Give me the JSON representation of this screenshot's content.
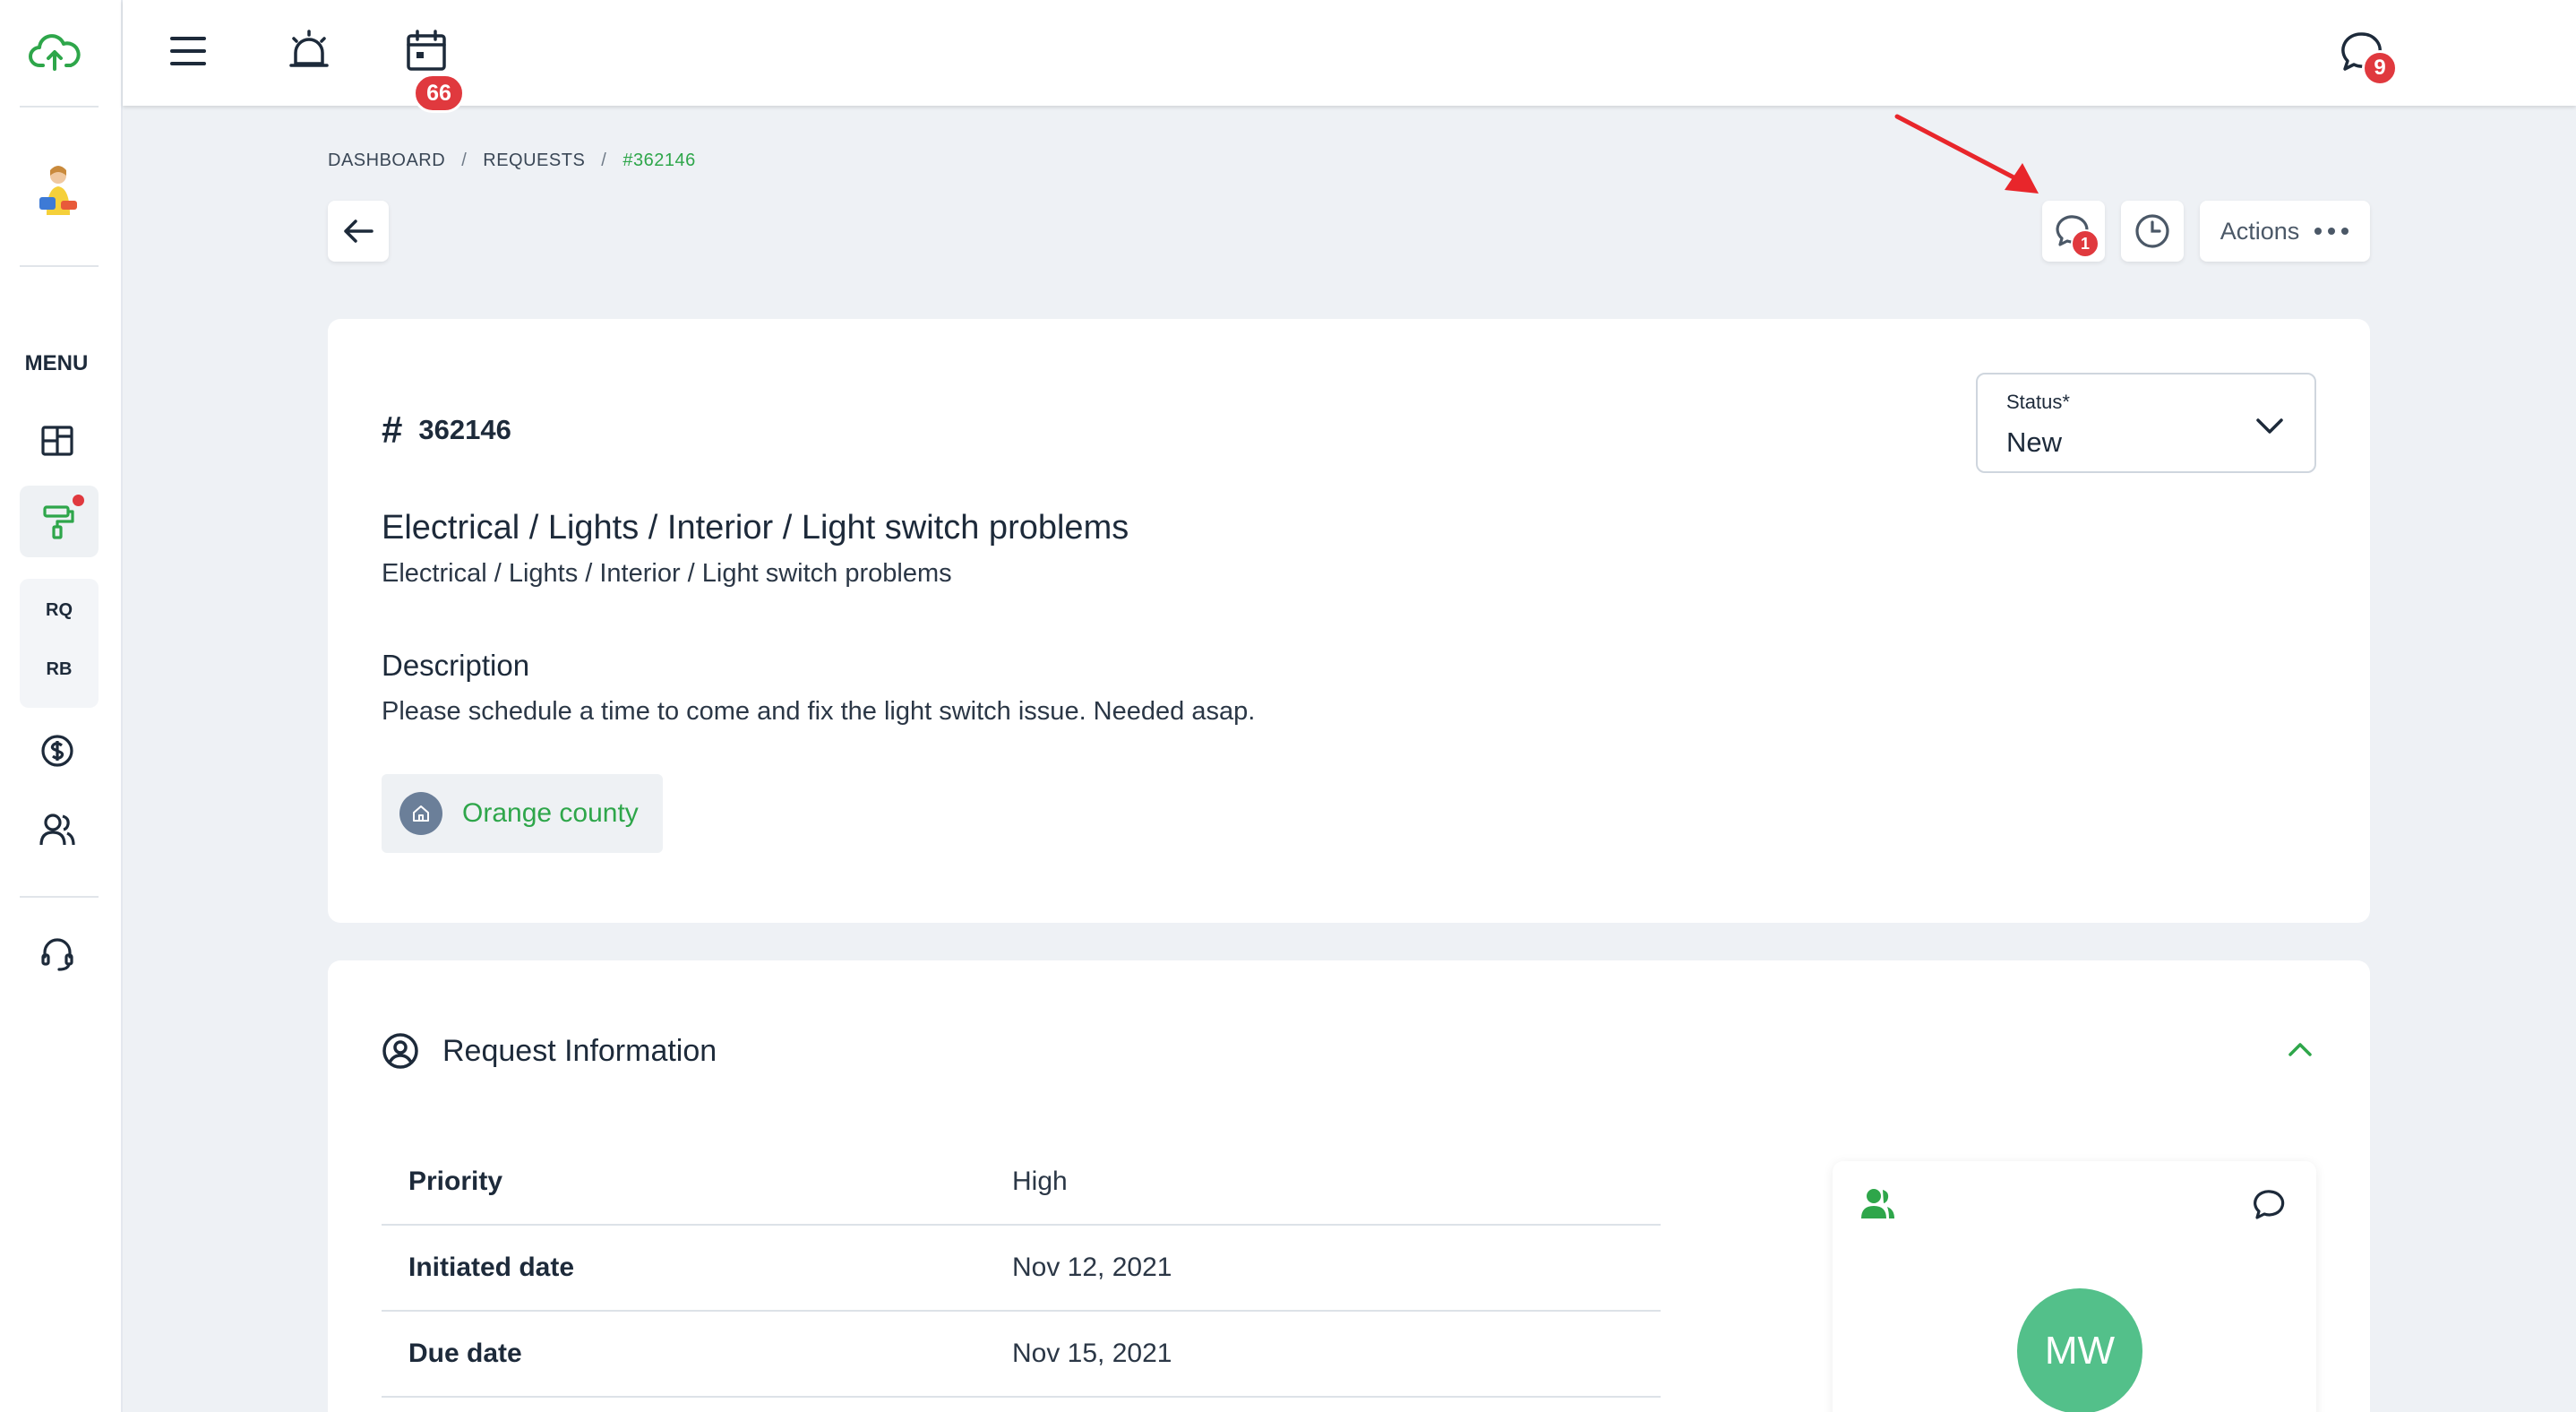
{
  "topbar": {
    "alerts_count": "66",
    "messages_count": "9"
  },
  "sidebar": {
    "menu_label": "MENU",
    "group_items": [
      "RQ",
      "RB"
    ]
  },
  "breadcrumb": {
    "items": [
      "DASHBOARD",
      "REQUESTS",
      "#362146"
    ],
    "separator": "/"
  },
  "header_actions": {
    "comments_count": "1",
    "actions_label": "Actions"
  },
  "request": {
    "id": "362146",
    "status_label": "Status*",
    "status_value": "New",
    "title": "Electrical / Lights / Interior / Light switch problems",
    "subtitle": "Electrical / Lights / Interior / Light switch problems",
    "description_heading": "Description",
    "description": "Please schedule a time to come and fix the light switch issue. Needed asap.",
    "location": "Orange county"
  },
  "request_info": {
    "heading": "Request Information",
    "rows": [
      {
        "key": "Priority",
        "value": "High"
      },
      {
        "key": "Initiated date",
        "value": "Nov 12, 2021"
      },
      {
        "key": "Due date",
        "value": "Nov 15, 2021"
      }
    ],
    "assignee_initials": "MW"
  },
  "colors": {
    "accent": "#2ea64a",
    "badge": "#e0393e",
    "background": "#eef1f5",
    "avatar": "#53c08a",
    "annotation_arrow": "#e8262b"
  }
}
